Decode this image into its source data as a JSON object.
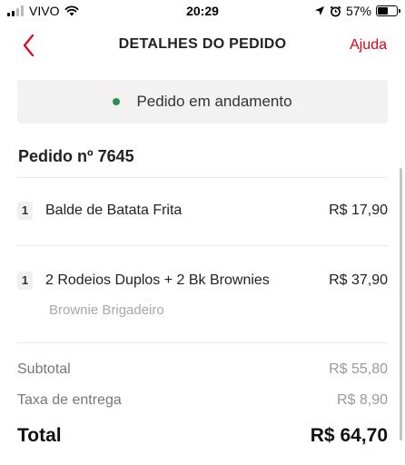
{
  "status_bar": {
    "carrier": "VIVO",
    "time": "20:29",
    "battery_percent": "57%",
    "battery_level": 0.57,
    "icons": [
      "signal-icon",
      "wifi-icon",
      "location-icon",
      "alarm-icon",
      "battery-icon"
    ]
  },
  "header": {
    "back_icon": "chevron-left-icon",
    "title": "DETALHES DO PEDIDO",
    "help_label": "Ajuda"
  },
  "status": {
    "text": "Pedido em andamento",
    "dot_color": "#2e8b57"
  },
  "order": {
    "title": "Pedido nº 7645",
    "items": [
      {
        "qty": "1",
        "name": "Balde de Batata Frita",
        "price": "R$ 17,90"
      },
      {
        "qty": "1",
        "name": "2 Rodeios Duplos + 2 Bk Brownies",
        "price": "R$ 37,90",
        "option": "Brownie Brigadeiro"
      }
    ]
  },
  "summary": {
    "subtotal_label": "Subtotal",
    "subtotal_value": "R$ 55,80",
    "delivery_label": "Taxa de entrega",
    "delivery_value": "R$ 8,90",
    "total_label": "Total",
    "total_value": "R$ 64,70"
  },
  "colors": {
    "accent": "#e5001a",
    "status_dot": "#2e8b57"
  }
}
